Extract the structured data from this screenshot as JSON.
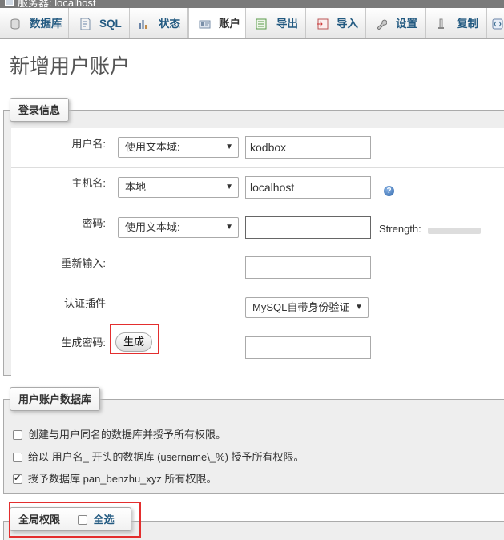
{
  "topbar": {
    "crumb": "服务器: localhost"
  },
  "tabs": [
    {
      "label": "数据库",
      "icon": "database-icon"
    },
    {
      "label": "SQL",
      "icon": "sql-icon"
    },
    {
      "label": "状态",
      "icon": "status-icon"
    },
    {
      "label": "账户",
      "icon": "user-accounts-icon",
      "active": true
    },
    {
      "label": "导出",
      "icon": "export-icon"
    },
    {
      "label": "导入",
      "icon": "import-icon"
    },
    {
      "label": "设置",
      "icon": "wrench-icon"
    },
    {
      "label": "复制",
      "icon": "replication-icon"
    }
  ],
  "page_title": "新增用户账户",
  "login": {
    "legend": "登录信息",
    "username": {
      "label": "用户名:",
      "select": "使用文本域:",
      "value": "kodbox"
    },
    "host": {
      "label": "主机名:",
      "select": "本地",
      "value": "localhost"
    },
    "password": {
      "label": "密码:",
      "select": "使用文本域:",
      "value": "",
      "strength_label": "Strength:"
    },
    "retype": {
      "label": "重新输入:",
      "value": ""
    },
    "auth_plugin": {
      "label": "认证插件",
      "select": "MySQL自带身份验证"
    },
    "generate": {
      "label": "生成密码:",
      "button": "生成",
      "value": ""
    }
  },
  "database": {
    "legend": "用户账户数据库",
    "options": [
      {
        "label": "创建与用户同名的数据库并授予所有权限。",
        "checked": false
      },
      {
        "label": "给以 用户名_ 开头的数据库 (username\\_%) 授予所有权限。",
        "checked": false
      },
      {
        "label": "授予数据库 pan_benzhu_xyz 所有权限。",
        "checked": true
      }
    ]
  },
  "global": {
    "legend": "全局权限",
    "select_all": "全选"
  },
  "colors": {
    "link": "#235a81",
    "highlight": "#e32e2e"
  }
}
